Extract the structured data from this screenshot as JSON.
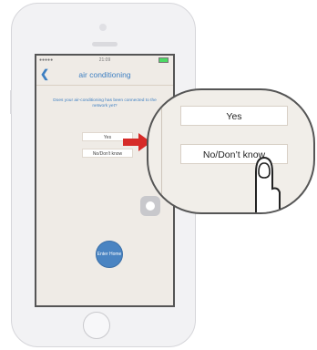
{
  "status": {
    "time": "21:09",
    "carrier": "●●●●●"
  },
  "nav": {
    "title": "air conditioning"
  },
  "question": "Does your air-conditioning has been connected to the network yet?",
  "options": {
    "yes": "Yes",
    "no": "No/Don't know"
  },
  "enter_home": "Enter Home",
  "zoom": {
    "yes": "Yes",
    "no": "No/Don’t know"
  },
  "colors": {
    "accent": "#3d7fc2",
    "arrow": "#d62a27",
    "button": "#4a84c2"
  }
}
